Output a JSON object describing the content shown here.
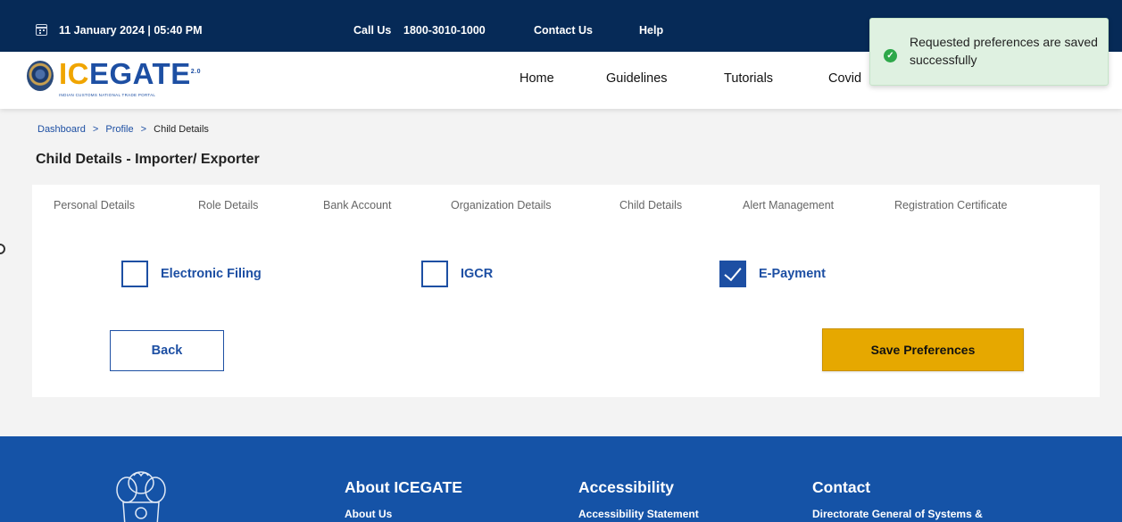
{
  "topbar": {
    "datetime": "11 January 2024 | 05:40 PM",
    "call_label": "Call Us",
    "call_number": "1800-3010-1000",
    "contact": "Contact Us",
    "help": "Help"
  },
  "logo": {
    "main": "ICEGATE",
    "superscript": "2.0",
    "sub": "INDIAN CUSTOMS NATIONAL TRADE PORTAL"
  },
  "nav": [
    "Home",
    "Guidelines",
    "Tutorials",
    "Covid"
  ],
  "toast": {
    "message": "Requested preferences are saved successfully",
    "icon": "check-circle-icon",
    "color": "#2ea84a"
  },
  "breadcrumb": {
    "items": [
      "Dashboard",
      "Profile",
      "Child Details"
    ],
    "separator": ">"
  },
  "page_title": "Child Details - Importer/ Exporter",
  "tabs": [
    "Personal Details",
    "Role Details",
    "Bank Account",
    "Organization Details",
    "Child Details",
    "Alert Management",
    "Registration Certificate"
  ],
  "preferences": [
    {
      "label": "Electronic Filing",
      "checked": false
    },
    {
      "label": "IGCR",
      "checked": false
    },
    {
      "label": "E-Payment",
      "checked": true
    }
  ],
  "buttons": {
    "back": "Back",
    "save": "Save Preferences"
  },
  "footer": {
    "columns": [
      {
        "heading": "About ICEGATE",
        "link": "About Us"
      },
      {
        "heading": "Accessibility",
        "link": "Accessibility Statement"
      },
      {
        "heading": "Contact",
        "link": "Directorate General of Systems &"
      }
    ]
  },
  "colors": {
    "topbar": "#062a57",
    "primary": "#1d4fa3",
    "accent": "#e6a800",
    "footer": "#1553a7",
    "toast_bg": "#dff1e1"
  }
}
